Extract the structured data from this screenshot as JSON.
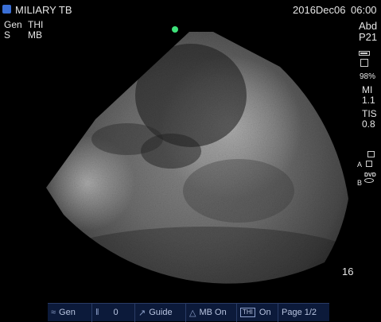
{
  "header": {
    "logo_icon": "sonosite-logo-icon",
    "title": "MILIARY TB",
    "mode_left_1": "Gen",
    "mode_left_2": "THI",
    "mode_left_3": "S",
    "mode_left_4": "MB",
    "date": "2016Dec06",
    "time": "06:00"
  },
  "right_panel": {
    "preset": "Abd",
    "probe": "P21",
    "level_percent": "98%",
    "mi_label": "MI",
    "mi_value": "1.1",
    "tis_label": "TIS",
    "tis_value": "0.8",
    "marker_a": "A",
    "marker_b": "B",
    "dvd_label": "DVD",
    "depth": "16"
  },
  "bottom_bar": {
    "items": [
      {
        "icon": "probe-icon",
        "label": "Gen"
      },
      {
        "icon": "gain-icon",
        "label": "0"
      },
      {
        "icon": "guide-icon",
        "label": "Guide"
      },
      {
        "icon": "mb-icon",
        "label": "MB On"
      },
      {
        "icon": "thi-icon",
        "label": "On"
      },
      {
        "icon": "",
        "label": "Page 1/2"
      }
    ]
  },
  "colors": {
    "orientation_dot": "#3ee27a",
    "bar_background": "#0c1a3a"
  }
}
